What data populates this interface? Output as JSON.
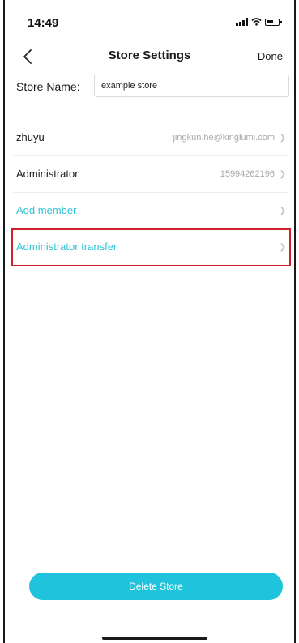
{
  "status_bar": {
    "time": "14:49"
  },
  "nav": {
    "title": "Store Settings",
    "done_label": "Done"
  },
  "store_name": {
    "label": "Store Name:",
    "value": "example store"
  },
  "members": [
    {
      "name": "zhuyu",
      "detail": "jingkun.he@kinglumi.com"
    },
    {
      "name": "Administrator",
      "detail": "15994262196"
    }
  ],
  "actions": {
    "add_member": "Add member",
    "admin_transfer": "Administrator transfer"
  },
  "delete_button": "Delete Store",
  "colors": {
    "accent": "#1fc4dc",
    "highlight": "#d0202a"
  }
}
